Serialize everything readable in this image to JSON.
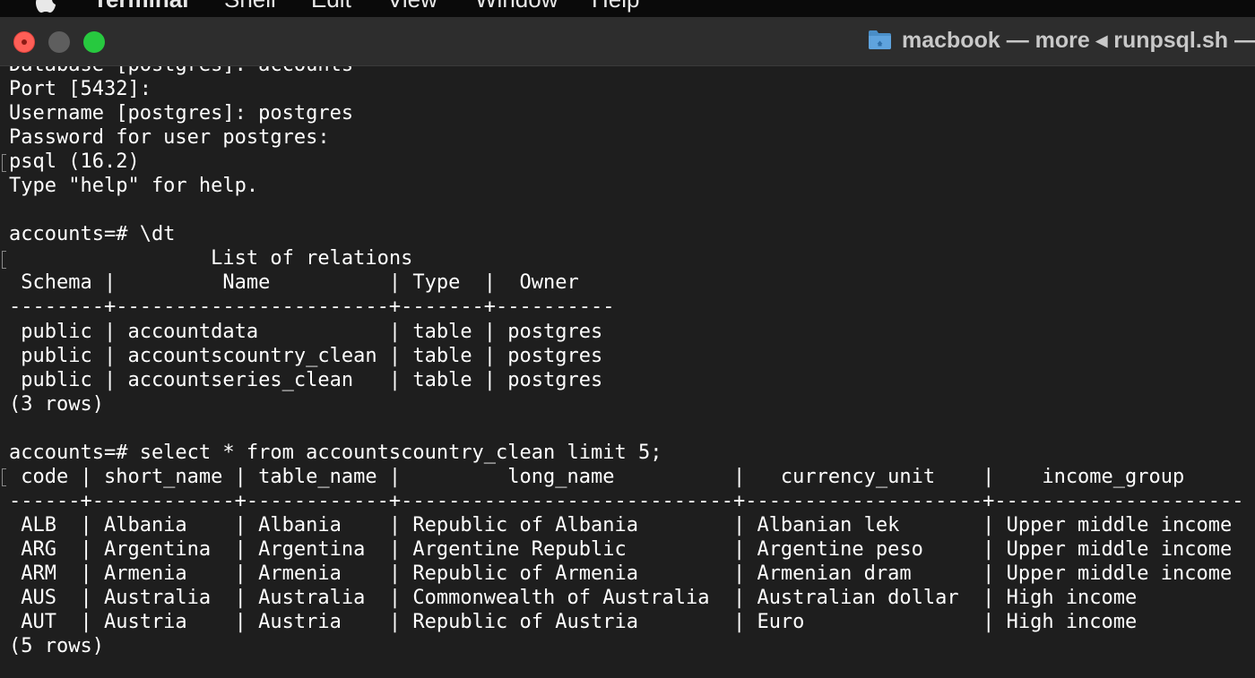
{
  "menubar": {
    "app_name": "Terminal",
    "items": [
      "Shell",
      "Edit",
      "View",
      "Window",
      "Help"
    ]
  },
  "window": {
    "title": "macbook — more ◂ runpsql.sh —"
  },
  "colors": {
    "terminal_bg": "#1e1e1e",
    "terminal_fg": "#ffffff",
    "titlebar_bg": "#2d2d2d",
    "close": "#fe5f57",
    "zoom": "#27c93f"
  },
  "terminal": {
    "lines": [
      "Database [postgres]: accounts",
      "Port [5432]:",
      "Username [postgres]: postgres",
      "Password for user postgres:",
      "psql (16.2)",
      "Type \"help\" for help.",
      "",
      "accounts=# \\dt",
      "                 List of relations",
      " Schema |         Name          | Type  |  Owner",
      "--------+-----------------------+-------+----------",
      " public | accountdata           | table | postgres",
      " public | accountscountry_clean | table | postgres",
      " public | accountseries_clean   | table | postgres",
      "(3 rows)",
      "",
      "accounts=# select * from accountscountry_clean limit 5;",
      " code | short_name | table_name |         long_name          |   currency_unit    |    income_group",
      "------+------------+------------+----------------------------+--------------------+---------------------",
      " ALB  | Albania    | Albania    | Republic of Albania        | Albanian lek       | Upper middle income",
      " ARG  | Argentina  | Argentina  | Argentine Republic         | Argentine peso     | Upper middle income",
      " ARM  | Armenia    | Armenia    | Republic of Armenia        | Armenian dram      | Upper middle income",
      " AUS  | Australia  | Australia  | Commonwealth of Australia  | Australian dollar  | High income",
      " AUT  | Austria    | Austria    | Republic of Austria        | Euro               | High income",
      "(5 rows)"
    ]
  }
}
